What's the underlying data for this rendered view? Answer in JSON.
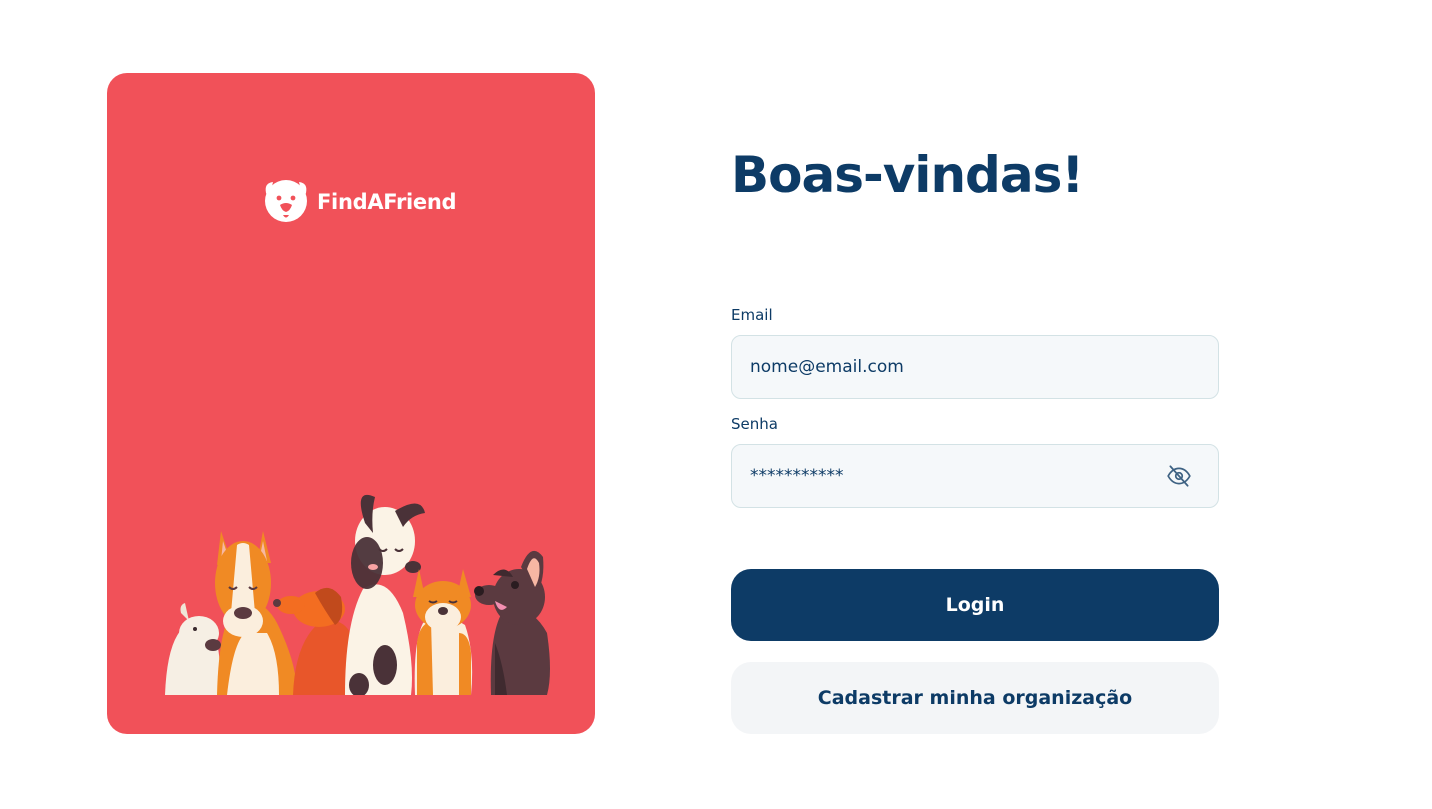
{
  "brand": {
    "name": "FindAFriend",
    "logo_icon": "dog-face-logo-icon"
  },
  "colors": {
    "primary": "#0d3b66",
    "accent": "#f15159",
    "input_bg": "#f5f8fa",
    "secondary_btn": "#f3f5f7"
  },
  "form": {
    "title": "Boas-vindas!",
    "email": {
      "label": "Email",
      "value": "nome@email.com"
    },
    "password": {
      "label": "Senha",
      "value": "***********",
      "toggle_icon": "eye-off-icon"
    },
    "login_label": "Login",
    "register_label": "Cadastrar minha organização"
  }
}
